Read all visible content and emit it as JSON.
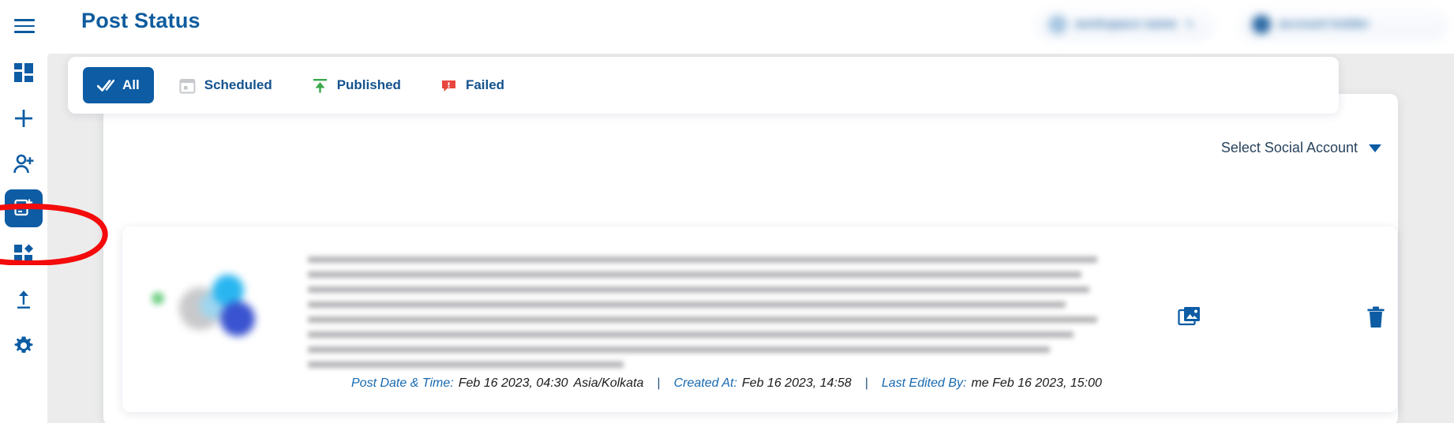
{
  "header": {
    "title": "Post Status",
    "menu_icon": "hamburger-icon",
    "workspace_chip": {
      "name": "workspace name",
      "edit_icon": "pencil-icon"
    },
    "user_chip": {
      "name": "account holder"
    }
  },
  "sidebar": {
    "items": [
      {
        "icon": "dashboard-grid-icon",
        "label": "Dashboard",
        "active": false
      },
      {
        "icon": "plus-icon",
        "label": "Create",
        "active": false
      },
      {
        "icon": "add-user-icon",
        "label": "Add User",
        "active": false
      },
      {
        "icon": "post-status-icon",
        "label": "Post Status",
        "active": true
      },
      {
        "icon": "apps-grid-icon",
        "label": "Apps",
        "active": false
      },
      {
        "icon": "upload-icon",
        "label": "Upload",
        "active": false
      },
      {
        "icon": "gear-icon",
        "label": "Settings",
        "active": false
      }
    ]
  },
  "tabs": [
    {
      "label": "All",
      "icon": "double-check-icon",
      "active": true
    },
    {
      "label": "Scheduled",
      "icon": "calendar-icon",
      "active": false
    },
    {
      "label": "Published",
      "icon": "upload-arrow-icon",
      "active": false
    },
    {
      "label": "Failed",
      "icon": "alert-comment-icon",
      "active": false
    }
  ],
  "filter": {
    "select_social_account_label": "Select Social Account",
    "caret_icon": "chevron-down-icon"
  },
  "post": {
    "content_redacted": true,
    "actions": [
      {
        "name": "media-icon",
        "label": "View Media"
      },
      {
        "name": "trash-icon",
        "label": "Delete Post"
      }
    ],
    "meta": {
      "post_date_label": "Post Date & Time:",
      "post_date_value": "Feb 16 2023, 04:30",
      "post_timezone": "Asia/Kolkata",
      "created_at_label": "Created At:",
      "created_at_value": "Feb 16 2023, 14:58",
      "last_edited_label": "Last Edited By:",
      "last_edited_value": "me Feb 16 2023, 15:00",
      "separator": "|"
    }
  },
  "annotation": {
    "shape": "ellipse",
    "color": "#f40b0b",
    "targets": "post-status-sidebar-item"
  },
  "colors": {
    "brand_blue": "#0d5ca4",
    "title_blue": "#0f5c9e",
    "canvas_gray": "#ececec",
    "published_green": "#3aa84a",
    "failed_red": "#e8453c",
    "annotation_red": "#f40b0b"
  }
}
